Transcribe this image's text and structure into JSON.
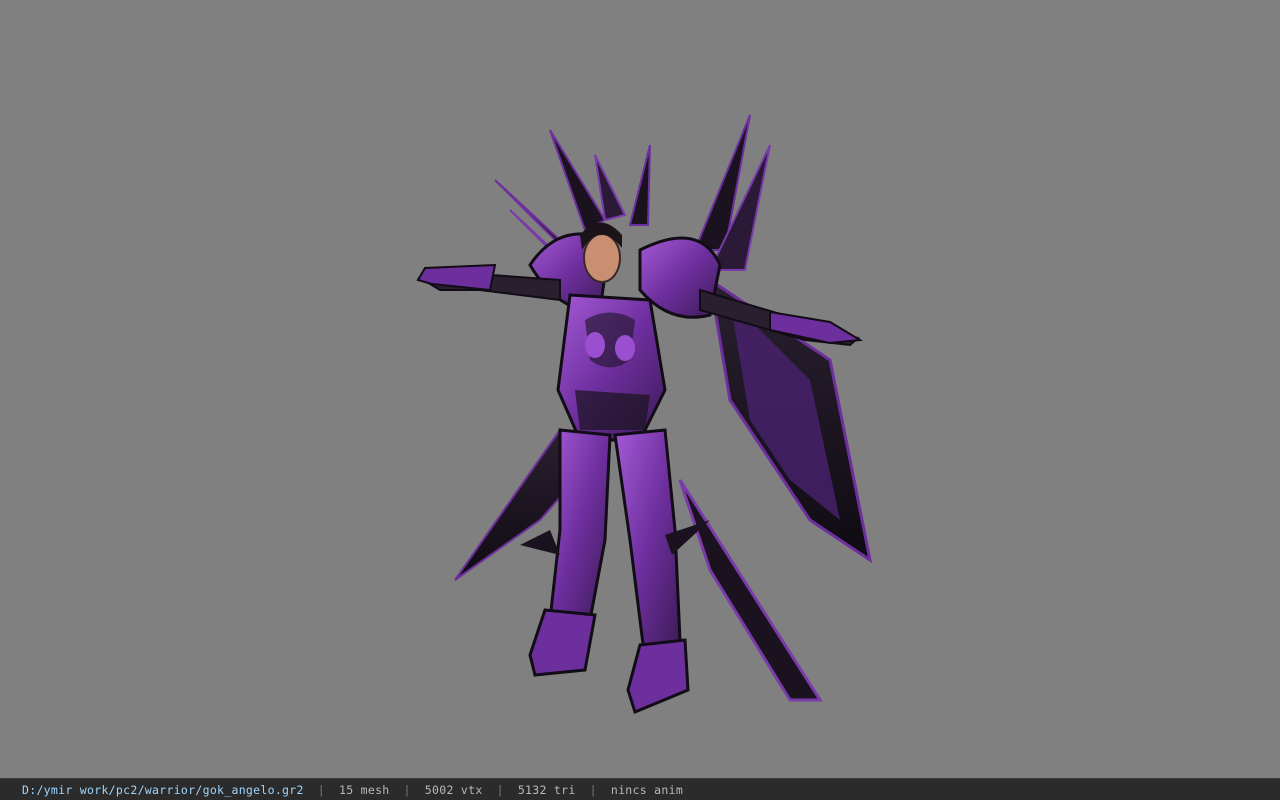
{
  "viewer": {
    "model_name": "armored-warrior-model",
    "colors": {
      "background": "#808080",
      "armor_primary": "#6e2f9e",
      "armor_dark": "#161018",
      "armor_highlight": "#a45ad6"
    }
  },
  "statusbar": {
    "file_path": "D:/ymir work/pc2/warrior/gok_angelo.gr2",
    "separator": "|",
    "mesh": "15 mesh",
    "vertices": "5002 vtx",
    "triangles": "5132 tri",
    "animation": "nincs anim"
  }
}
